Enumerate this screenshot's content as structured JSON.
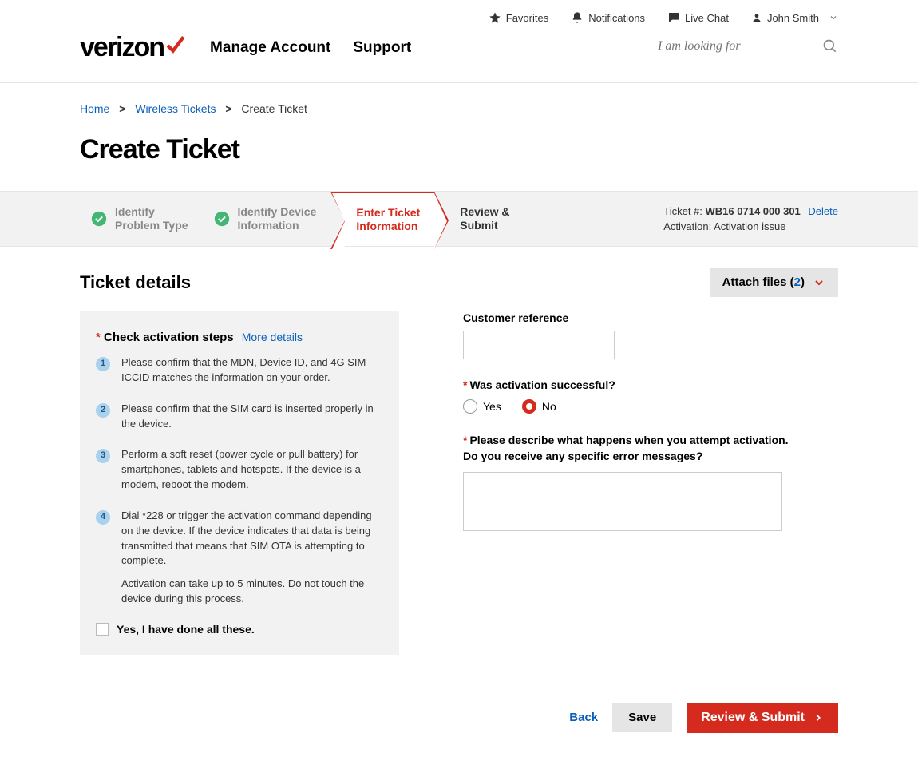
{
  "utility": {
    "favorites": "Favorites",
    "notifications": "Notifications",
    "live_chat": "Live Chat",
    "user": "John Smith"
  },
  "brand": {
    "name": "verizon"
  },
  "nav": {
    "manage": "Manage Account",
    "support": "Support"
  },
  "search": {
    "placeholder": "I am looking for"
  },
  "breadcrumb": {
    "home": "Home",
    "wireless": "Wireless Tickets",
    "current": "Create Ticket"
  },
  "page_title": "Create Ticket",
  "wizard": {
    "step1": {
      "line1": "Identify",
      "line2": "Problem Type"
    },
    "step2": {
      "line1": "Identify Device",
      "line2": "Information"
    },
    "step3": {
      "line1": "Enter Ticket",
      "line2": "Information"
    },
    "step4": {
      "line1": "Review &",
      "line2": "Submit"
    },
    "ticket_label": "Ticket #:",
    "ticket_number": "WB16 0714 000 301",
    "delete": "Delete",
    "activation_label": "Activation: Activation issue"
  },
  "section": {
    "title": "Ticket details",
    "attach_label": "Attach files (",
    "attach_count": "2",
    "attach_close": ")"
  },
  "card": {
    "title": "Check activation steps",
    "more": "More details",
    "steps": {
      "s1": "Please confirm that the MDN, Device ID, and 4G SIM ICCID matches the information on your order.",
      "s2": "Please confirm that the SIM card is inserted properly in the device.",
      "s3": "Perform a soft reset (power cycle or pull battery) for smartphones, tablets and hotspots. If the device is a modem, reboot the modem.",
      "s4a": "Dial *228 or trigger the activation command depending on the device. If the device indicates that data is being transmitted that means that SIM OTA is attempting to complete.",
      "s4b": "Activation can take up to 5 minutes. Do not touch the device during this process."
    },
    "confirm": "Yes, I have done all these."
  },
  "form": {
    "cust_ref": "Customer reference",
    "activation_q": "Was activation successful?",
    "yes": "Yes",
    "no": "No",
    "describe_q1": "Please describe what happens when you attempt activation.",
    "describe_q2": "Do you receive any specific error messages?"
  },
  "actions": {
    "back": "Back",
    "save": "Save",
    "submit": "Review & Submit"
  }
}
